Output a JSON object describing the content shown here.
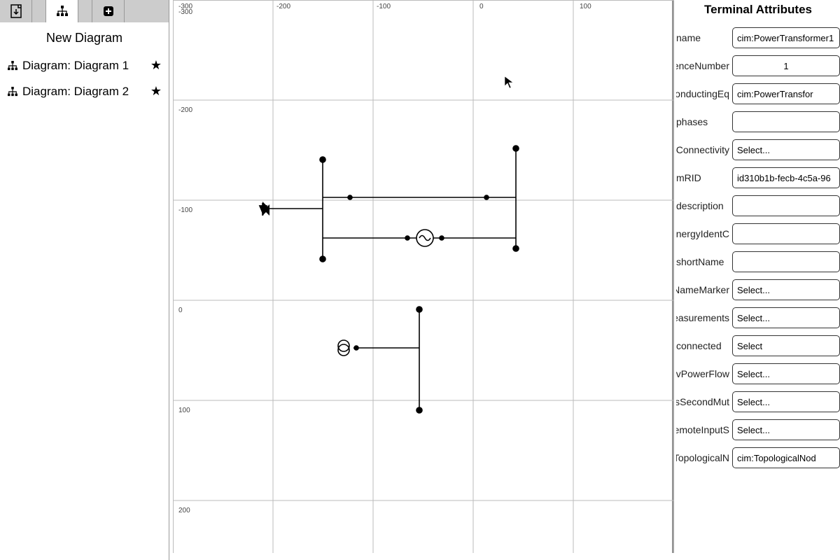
{
  "sidebar": {
    "title": "New Diagram",
    "diagrams": [
      {
        "label": "Diagram: Diagram 1"
      },
      {
        "label": "Diagram: Diagram 2"
      }
    ]
  },
  "grid": {
    "x_ticks": [
      "-300",
      "-200",
      "-100",
      "0",
      "100"
    ],
    "y_ticks": [
      "-300",
      "-200",
      "-100",
      "0",
      "100",
      "200"
    ]
  },
  "attributes": {
    "title": "Terminal Attributes",
    "rows": [
      {
        "label": "name",
        "value": "cim:PowerTransformer1",
        "type": "text"
      },
      {
        "label": "sequenceNumber",
        "value": "1",
        "type": "text",
        "center": true
      },
      {
        "label": "ConductingEq..",
        "value": "cim:PowerTransfor",
        "type": "text"
      },
      {
        "label": "phases",
        "value": "",
        "type": "text"
      },
      {
        "label": "Connectivity..",
        "value": "Select...",
        "type": "select"
      },
      {
        "label": "mRID",
        "value": "id310b1b-fecb-4c5a-96",
        "type": "text"
      },
      {
        "label": "description",
        "value": "",
        "type": "text"
      },
      {
        "label": "energyIdentC..",
        "value": "",
        "type": "text"
      },
      {
        "label": "shortName",
        "value": "",
        "type": "text"
      },
      {
        "label": "BusNameMarker",
        "value": "Select...",
        "type": "select"
      },
      {
        "label": "Measurements",
        "value": "Select...",
        "type": "select"
      },
      {
        "label": "connected",
        "value": "Select",
        "type": "select"
      },
      {
        "label": "SvPowerFlow",
        "value": "Select...",
        "type": "select"
      },
      {
        "label": "HasSecondMut..",
        "value": "Select...",
        "type": "select"
      },
      {
        "label": "RemoteInputS..",
        "value": "Select...",
        "type": "select"
      },
      {
        "label": "TopologicalN..",
        "value": "cim:TopologicalNod",
        "type": "text"
      }
    ]
  },
  "icons": {
    "file": "file-icon",
    "tree": "tree-icon",
    "plus": "plus-icon",
    "star": "★"
  }
}
